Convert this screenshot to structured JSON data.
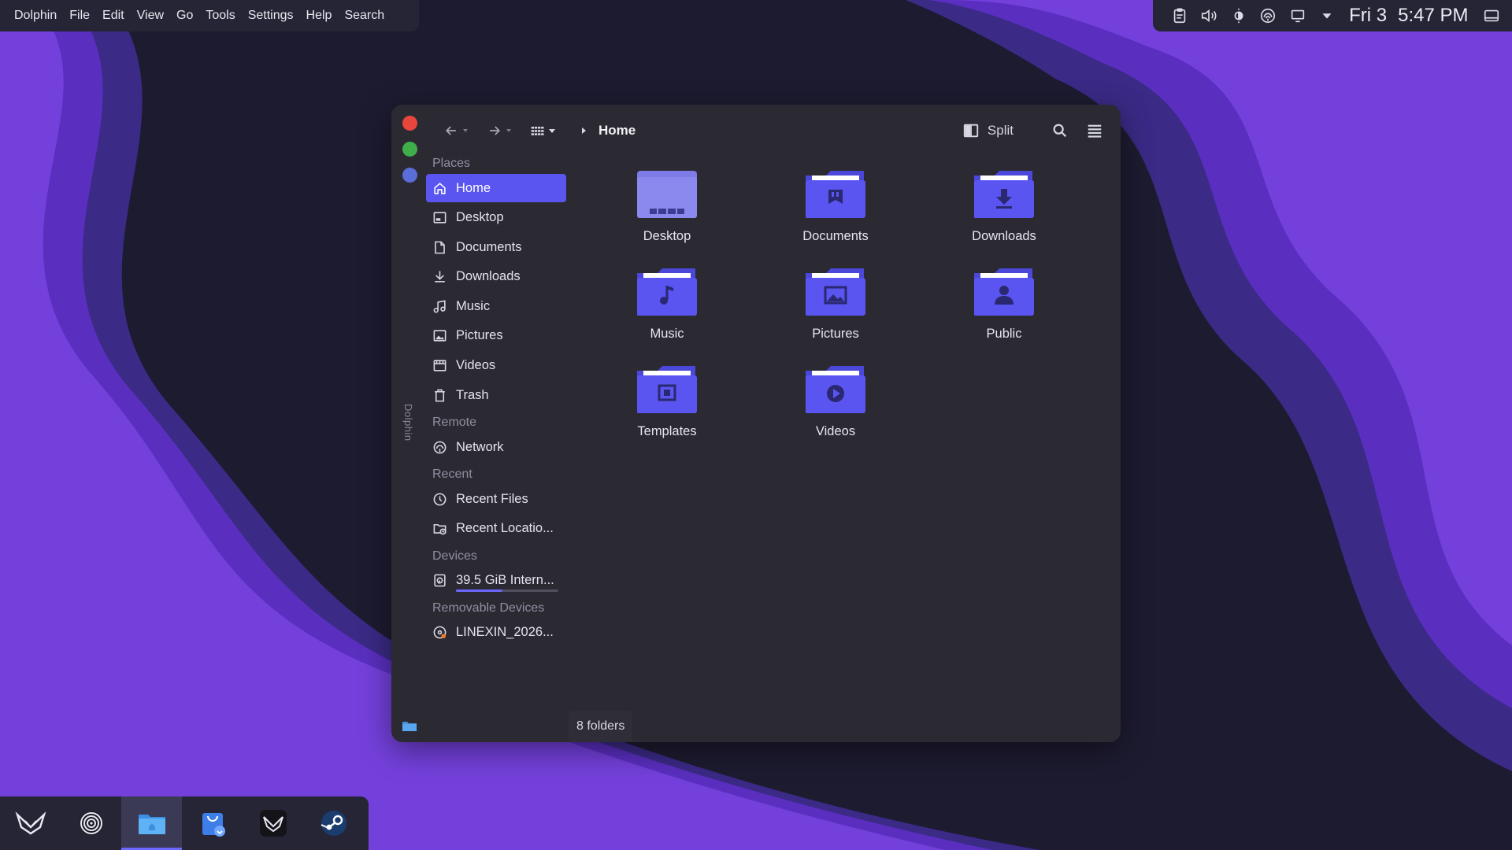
{
  "menubar": {
    "items": [
      "Dolphin",
      "File",
      "Edit",
      "View",
      "Go",
      "Tools",
      "Settings",
      "Help",
      "Search"
    ]
  },
  "tray": {
    "icons": [
      "clipboard-icon",
      "volume-icon",
      "brightness-icon",
      "network-icon",
      "display-icon",
      "expand-arrow-icon"
    ],
    "date": "Fri 3",
    "time": "5:47 PM"
  },
  "window": {
    "vertical_title": "Dolphin",
    "breadcrumb": "Home",
    "split_label": "Split",
    "sidebar": {
      "places_title": "Places",
      "places": [
        "Home",
        "Desktop",
        "Documents",
        "Downloads",
        "Music",
        "Pictures",
        "Videos",
        "Trash"
      ],
      "remote_title": "Remote",
      "remote": [
        "Network"
      ],
      "recent_title": "Recent",
      "recent": [
        "Recent Files",
        "Recent Locatio..."
      ],
      "devices_title": "Devices",
      "devices": [
        "39.5 GiB Intern..."
      ],
      "device_usage_fraction": 0.45,
      "removable_title": "Removable Devices",
      "removable": [
        "LINEXIN_2026..."
      ]
    },
    "folders": [
      "Desktop",
      "Documents",
      "Downloads",
      "Music",
      "Pictures",
      "Public",
      "Templates",
      "Videos"
    ],
    "status": "8 folders"
  },
  "taskbar": {
    "apps": [
      "linexin-launcher",
      "settings-spiral",
      "dolphin-files",
      "software-store",
      "linexin-app",
      "steam"
    ]
  },
  "colors": {
    "accent": "#5a55f0",
    "close": "#e8453c",
    "maximize": "#3fae4a",
    "minimize": "#5a6ed8",
    "folder": "#5a55f0"
  }
}
